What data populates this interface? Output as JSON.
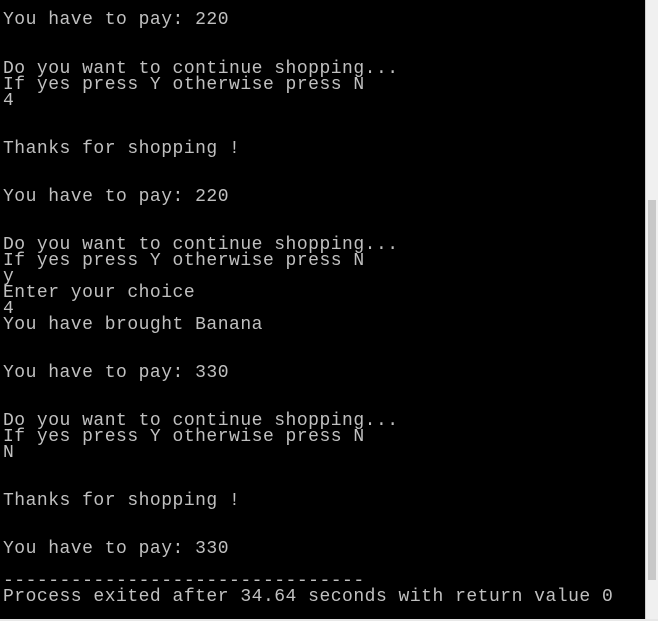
{
  "console": {
    "lines": [
      "You have to pay: 220",
      "Do you want to continue shopping...",
      "If yes press Y otherwise press N",
      "4",
      "Thanks for shopping !",
      "You have to pay: 220",
      "Do you want to continue shopping...",
      "If yes press Y otherwise press N",
      "y",
      "Enter your choice",
      "4",
      "You have brought Banana",
      "You have to pay: 330",
      "Do you want to continue shopping...",
      "If yes press Y otherwise press N",
      "N",
      "Thanks for shopping !",
      "You have to pay: 330",
      "--------------------------------",
      "Process exited after 34.64 seconds with return value 0"
    ]
  },
  "colors": {
    "background": "#000000",
    "text": "#c0c0c0"
  }
}
